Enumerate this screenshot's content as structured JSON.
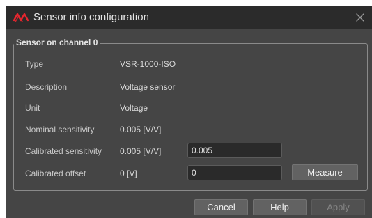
{
  "window": {
    "title": "Sensor info configuration",
    "icon": "waveform-icon",
    "close_icon": "close-icon"
  },
  "group": {
    "title": "Sensor on channel 0"
  },
  "rows": [
    {
      "label": "Type",
      "value": "VSR-1000-ISO"
    },
    {
      "label": "Description",
      "value": "Voltage sensor"
    },
    {
      "label": "Unit",
      "value": "Voltage"
    },
    {
      "label": "Nominal sensitivity",
      "value": "0.005 [V/V]"
    },
    {
      "label": "Calibrated sensitivity",
      "value": "0.005 [V/V]",
      "input_value": "0.005"
    },
    {
      "label": "Calibrated offset",
      "value": "0 [V]",
      "input_value": "0"
    }
  ],
  "buttons": {
    "measure": "Measure",
    "cancel": "Cancel",
    "help": "Help",
    "apply": "Apply"
  },
  "colors": {
    "accent_icon": "#e8262e",
    "window_bg": "#454545",
    "titlebar_bg": "#2b2b2b"
  }
}
